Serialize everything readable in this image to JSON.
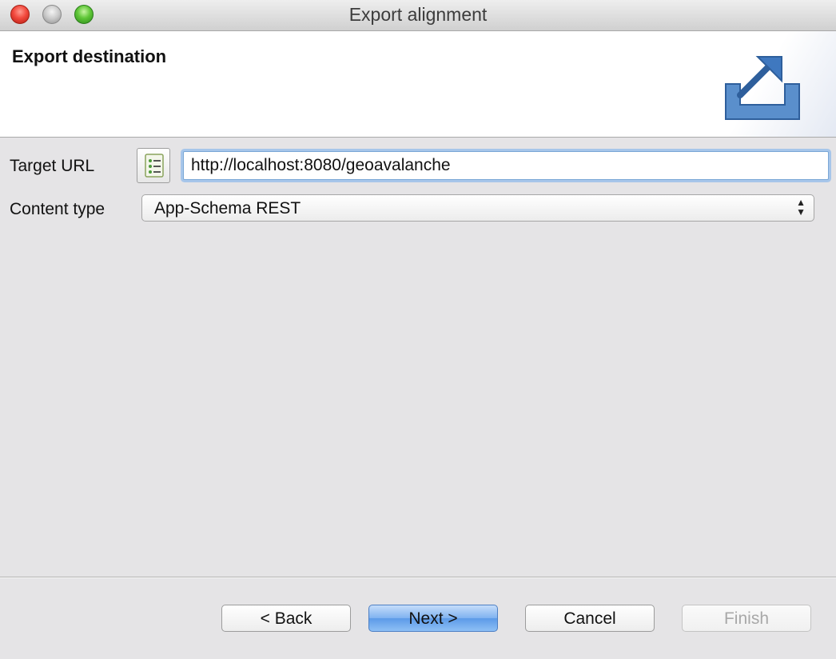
{
  "window": {
    "title": "Export alignment"
  },
  "header": {
    "title": "Export destination",
    "icon": "export-icon"
  },
  "form": {
    "target_url_label": "Target URL",
    "target_url_value": "http://localhost:8080/geoavalanche",
    "content_type_label": "Content type",
    "content_type_value": "App-Schema REST"
  },
  "buttons": {
    "back": "< Back",
    "next": "Next >",
    "cancel": "Cancel",
    "finish": "Finish"
  },
  "colors": {
    "accent": "#5c9ae8",
    "focus_ring": "#a7c6ea"
  }
}
